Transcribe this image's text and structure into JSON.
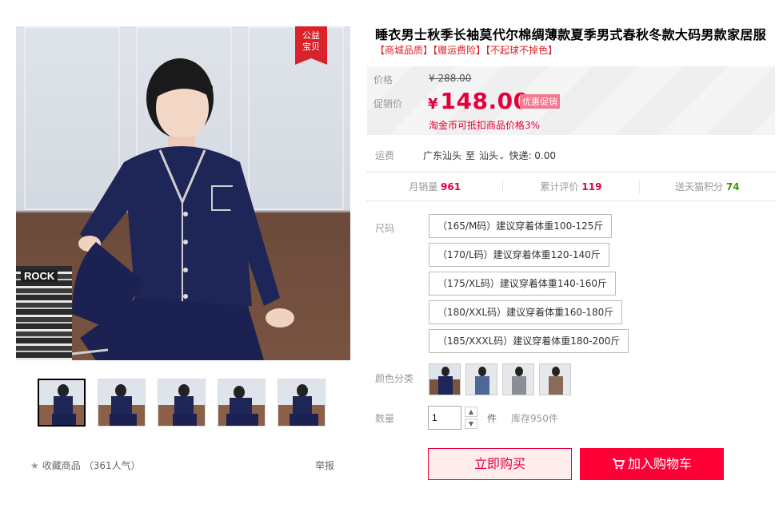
{
  "product": {
    "title": "睡衣男士秋季长袖莫代尔棉绸薄款夏季男式春秋冬款大码男款家居服",
    "tags": "【商城品质】【赠运费险】【不起球不掉色】",
    "badge_line1": "公益",
    "badge_line2": "宝贝",
    "books_label": "ROCK"
  },
  "price": {
    "label": "价格",
    "old_value": "¥ 288.00",
    "promo_label": "促销价",
    "currency": "¥",
    "promo_value": "148.00",
    "promo_tag": "优惠促销",
    "coin_note": "淘金币可抵扣商品价格3%"
  },
  "shipping": {
    "label": "运费",
    "from": "广东汕头",
    "to_word": "至",
    "dest": "汕头",
    "express": "快递: 0.00"
  },
  "stats": {
    "monthly_sales_label": "月销量",
    "monthly_sales": "961",
    "reviews_label": "累计评价",
    "reviews": "119",
    "points_label": "送天猫积分",
    "points": "74"
  },
  "size": {
    "label": "尺码",
    "options": [
      "（165/M码）建议穿着体重100-125斤",
      "（170/L码）建议穿着体重120-140斤",
      "（175/XL码）建议穿着体重140-160斤",
      "（180/XXL码）建议穿着体重160-180斤",
      "（185/XXXL码）建议穿着体重180-200斤"
    ]
  },
  "color": {
    "label": "颜色分类"
  },
  "quantity": {
    "label": "数量",
    "value": "1",
    "unit": "件",
    "stock": "库存950件"
  },
  "actions": {
    "buy_now": "立即购买",
    "add_to_cart": "加入购物车",
    "favorite": "收藏商品",
    "popularity": "（361人气）",
    "report": "举报"
  },
  "colors": {
    "accent": "#e4003a",
    "cart": "#ff0036",
    "pajama_navy": "#1e2557"
  }
}
